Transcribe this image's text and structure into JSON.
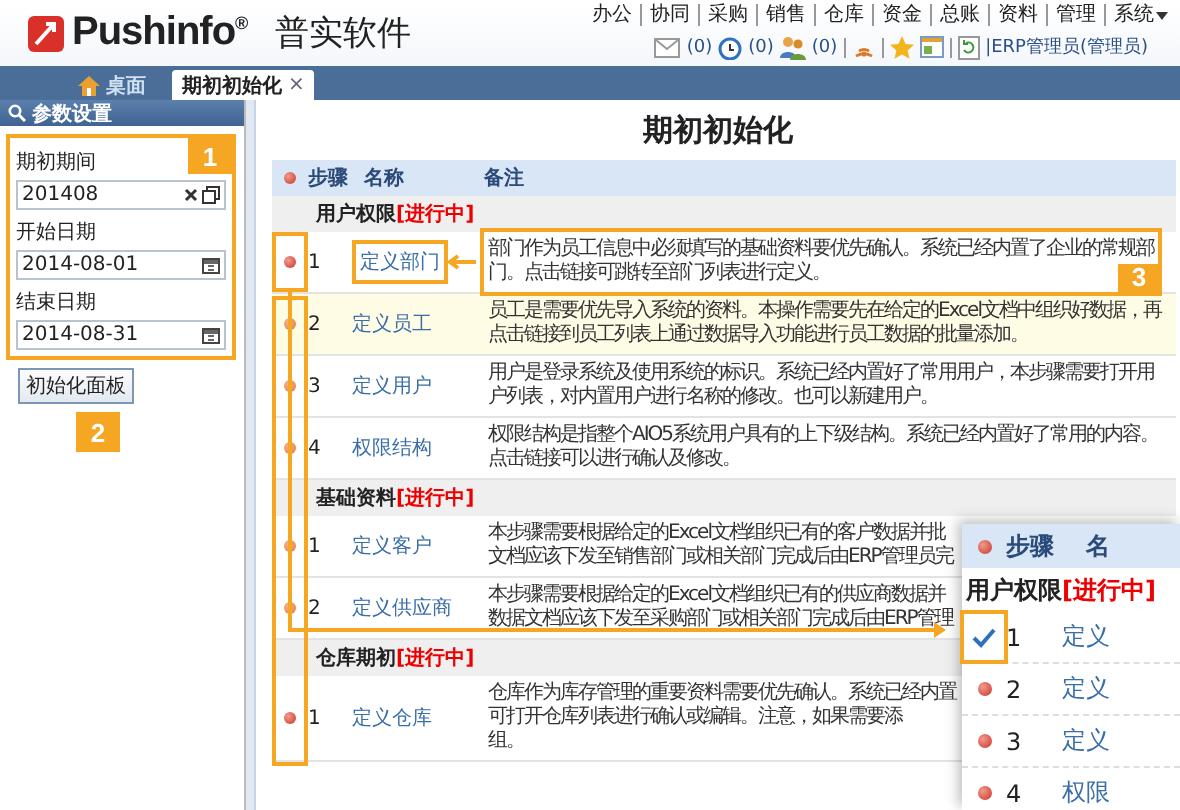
{
  "header": {
    "brand": "Pushinfo",
    "brand_mark": "®",
    "product": "普实软件",
    "menu": [
      {
        "label": "办公",
        "kind": "link"
      },
      {
        "label": "协同",
        "kind": "link"
      },
      {
        "label": "采购",
        "kind": "link"
      },
      {
        "label": "销售",
        "kind": "link"
      },
      {
        "label": "仓库",
        "kind": "link"
      },
      {
        "label": "资金",
        "kind": "link"
      },
      {
        "label": "总账",
        "kind": "link"
      },
      {
        "label": "资料",
        "kind": "link"
      },
      {
        "label": "管理",
        "kind": "link"
      },
      {
        "label": "系统",
        "kind": "dropdown"
      }
    ],
    "notifications": [
      {
        "kind": "mail",
        "count": "(0)"
      },
      {
        "kind": "clock",
        "count": "(0)"
      },
      {
        "kind": "people",
        "count": "(0)"
      }
    ],
    "user": "|ERP管理员(管理员)"
  },
  "tabs": [
    {
      "label": "桌面",
      "kind": "home",
      "selected": false
    },
    {
      "label": "期初初始化",
      "kind": "page",
      "selected": true,
      "close": "×"
    }
  ],
  "sidebar": {
    "title": "参数设置",
    "callout": "1",
    "fields": [
      {
        "label": "期初期间",
        "value": "201408",
        "kind": "period"
      },
      {
        "label": "开始日期",
        "value": "2014-08-01",
        "kind": "date"
      },
      {
        "label": "结束日期",
        "value": "2014-08-31",
        "kind": "date"
      }
    ],
    "button": "初始化面板",
    "button_callout": "2"
  },
  "main": {
    "title": "期初初始化",
    "columns": [
      "步骤",
      "名称",
      "备注"
    ],
    "sections": [
      {
        "title": "用户权限",
        "status": "[进行中]",
        "rows": [
          {
            "step": "1",
            "name": "定义部门",
            "current": true,
            "highlighted": false,
            "callout": "3",
            "desc": [
              "部门作为员工信息中必须填写的基础资料要优先确认。系统已经内置了企业的常规部",
              "门。点击链接可跳转至部门列表进行定义。"
            ]
          },
          {
            "step": "2",
            "name": "定义员工",
            "current": false,
            "highlighted": true,
            "desc": [
              "员工是需要优先导入系统的资料。本操作需要先在给定的Excel文档中组织好数据，再",
              "点击链接到员工列表上通过数据导入功能进行员工数据的批量添加。"
            ]
          },
          {
            "step": "3",
            "name": "定义用户",
            "current": false,
            "highlighted": false,
            "desc": [
              "用户是登录系统及使用系统的标识。系统已经内置好了常用用户，本步骤需要打开用",
              "户列表，对内置用户进行名称的修改。也可以新建用户。"
            ]
          },
          {
            "step": "4",
            "name": "权限结构",
            "current": false,
            "highlighted": false,
            "desc": [
              "权限结构是指整个AIO5系统用户具有的上下级结构。系统已经内置好了常用的内容。",
              "点击链接可以进行确认及修改。"
            ]
          }
        ]
      },
      {
        "title": "基础资料",
        "status": "[进行中]",
        "rows": [
          {
            "step": "1",
            "name": "定义客户",
            "current": false,
            "highlighted": false,
            "desc": [
              "本步骤需要根据给定的Excel文档组织已有的客户数据并批",
              "文档应该下发至销售部门或相关部门完成后由ERP管理员完"
            ]
          },
          {
            "step": "2",
            "name": "定义供应商",
            "current": false,
            "highlighted": false,
            "desc": [
              "本步骤需要根据给定的Excel文档组织已有的供应商数据并",
              "数据文档应该下发至采购部门或相关部门完成后由ERP管理"
            ]
          }
        ]
      },
      {
        "title": "仓库期初",
        "status": "[进行中]",
        "rows": [
          {
            "step": "1",
            "name": "定义仓库",
            "current": true,
            "highlighted": false,
            "desc": [
              "仓库作为库存管理的重要资料需要优先确认。系统已经内置",
              "可打开仓库列表进行确认或编辑。注意，如果需要添",
              "组。"
            ]
          }
        ]
      }
    ]
  },
  "inset": {
    "columns": [
      "步骤",
      "名"
    ],
    "section": {
      "title": "用户权限",
      "status": "[进行中]"
    },
    "rows": [
      {
        "step": "1",
        "name": "定义",
        "done": true
      },
      {
        "step": "2",
        "name": "定义",
        "done": false
      },
      {
        "step": "3",
        "name": "定义",
        "done": false
      },
      {
        "step": "4",
        "name": "权限",
        "done": false
      }
    ]
  }
}
